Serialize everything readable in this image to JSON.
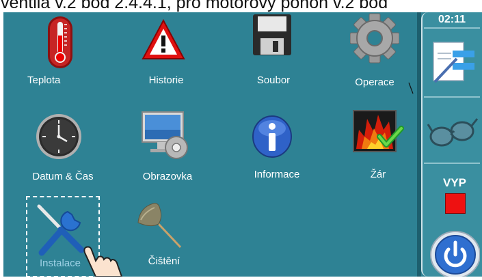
{
  "top_strip_text": "ventila v.2 bod 2.4.4.1, pro motorový pohon v.2 bod",
  "clock": "02:11",
  "items": [
    {
      "label": "Teplota",
      "icon": "thermometer-icon"
    },
    {
      "label": "Historie",
      "icon": "warning-icon"
    },
    {
      "label": "Soubor",
      "icon": "floppy-disk-icon"
    },
    {
      "label": "Operace",
      "icon": "gear-icon"
    },
    {
      "label": "Datum & Čas",
      "icon": "clock-icon"
    },
    {
      "label": "Obrazovka",
      "icon": "monitor-icon"
    },
    {
      "label": "Informace",
      "icon": "info-icon"
    },
    {
      "label": "Žár",
      "icon": "fire-check-icon"
    },
    {
      "label": "Instalace",
      "icon": "tools-icon"
    },
    {
      "label": "Čištění",
      "icon": "broom-icon"
    }
  ],
  "sidebar": {
    "status_label": "VYP",
    "buttons": [
      "notes-edit-icon",
      "glasses-icon",
      "stop-square-icon",
      "power-icon"
    ]
  },
  "colors": {
    "background": "#2e8294",
    "sidebar": "#3a8fa0",
    "stop": "#ee1111",
    "power": "#2f6fd0"
  }
}
